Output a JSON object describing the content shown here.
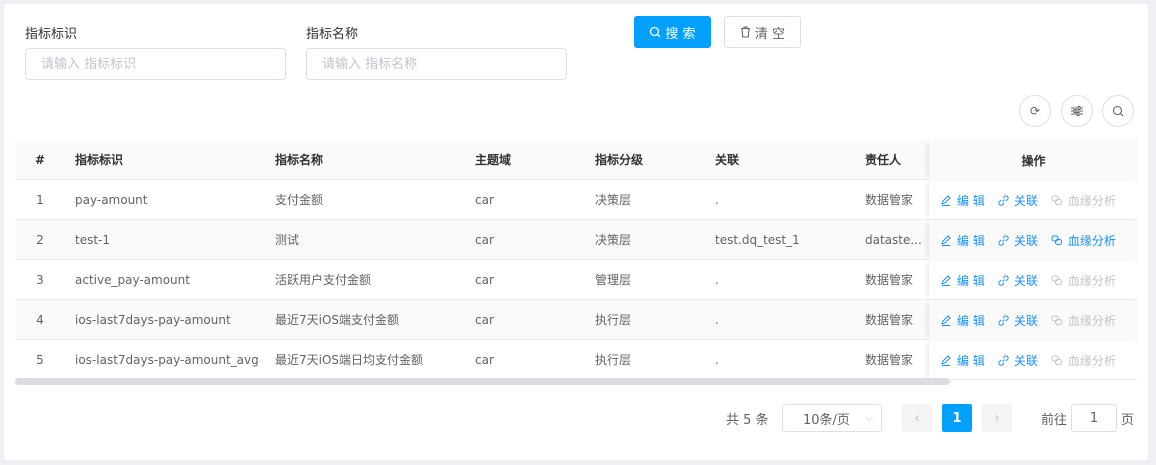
{
  "filters": [
    {
      "label": "指标标识",
      "placeholder": "请输入 指标标识"
    },
    {
      "label": "指标名称",
      "placeholder": "请输入 指标名称"
    }
  ],
  "buttons": {
    "search": "搜 索",
    "clear": "清 空"
  },
  "toolbar_icons": [
    "refresh-icon",
    "filter-settings-icon",
    "search-icon"
  ],
  "colors": {
    "primary": "#00a0ff",
    "link": "#1890ff",
    "disabled": "#c0c4cc"
  },
  "table": {
    "headers": [
      "#",
      "指标标识",
      "指标名称",
      "主题域",
      "指标分级",
      "关联",
      "责任人",
      "操作"
    ],
    "rows": [
      {
        "idx": "1",
        "id": "pay-amount",
        "name": "支付金额",
        "domain": "car",
        "level": "决策层",
        "rel": ".",
        "owner": "数据管家",
        "lineage_enabled": false
      },
      {
        "idx": "2",
        "id": "test-1",
        "name": "测试",
        "domain": "car",
        "level": "决策层",
        "rel": "test.dq_test_1",
        "owner": "dataste...",
        "lineage_enabled": true
      },
      {
        "idx": "3",
        "id": "active_pay-amount",
        "name": "活跃用户支付金额",
        "domain": "car",
        "level": "管理层",
        "rel": ".",
        "owner": "数据管家",
        "lineage_enabled": false
      },
      {
        "idx": "4",
        "id": "ios-last7days-pay-amount",
        "name": "最近7天iOS端支付金额",
        "domain": "car",
        "level": "执行层",
        "rel": ".",
        "owner": "数据管家",
        "lineage_enabled": false
      },
      {
        "idx": "5",
        "id": "ios-last7days-pay-amount_avg",
        "name": "最近7天iOS端日均支付金额",
        "domain": "car",
        "level": "执行层",
        "rel": ".",
        "owner": "数据管家",
        "lineage_enabled": false
      }
    ],
    "actions": {
      "edit": "编 辑",
      "link": "关联",
      "lineage": "血缘分析"
    }
  },
  "pagination": {
    "total": "共 5 条",
    "page_size": "10条/页",
    "current": "1",
    "goto_label": "前往",
    "goto_value": "1",
    "page_suffix": "页"
  }
}
